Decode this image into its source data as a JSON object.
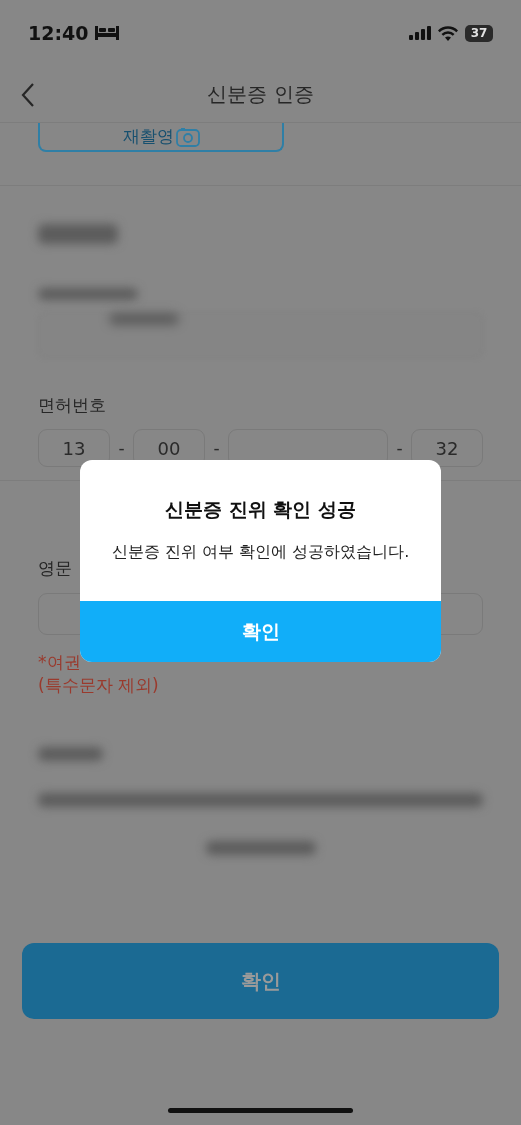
{
  "status_bar": {
    "time": "12:40",
    "battery": "37"
  },
  "nav": {
    "title": "신분증 인증"
  },
  "reshoot_button": {
    "label": "재촬영"
  },
  "license": {
    "label": "면허번호",
    "parts": [
      {
        "value": "13"
      },
      {
        "separator": "-",
        "value": "00"
      },
      {
        "separator": "-"
      },
      {
        "separator": "-",
        "value": "32"
      }
    ]
  },
  "english_name": {
    "label": "영문",
    "note_lines": [
      "*여권",
      "(특수문자 제외)"
    ]
  },
  "confirm_button": {
    "label": "확인",
    "disabled": true
  },
  "dialog": {
    "title": "신분증 진위 확인 성공",
    "message": "신분증 진위 여부 확인에 성공하였습니다.",
    "button": "확인"
  }
}
